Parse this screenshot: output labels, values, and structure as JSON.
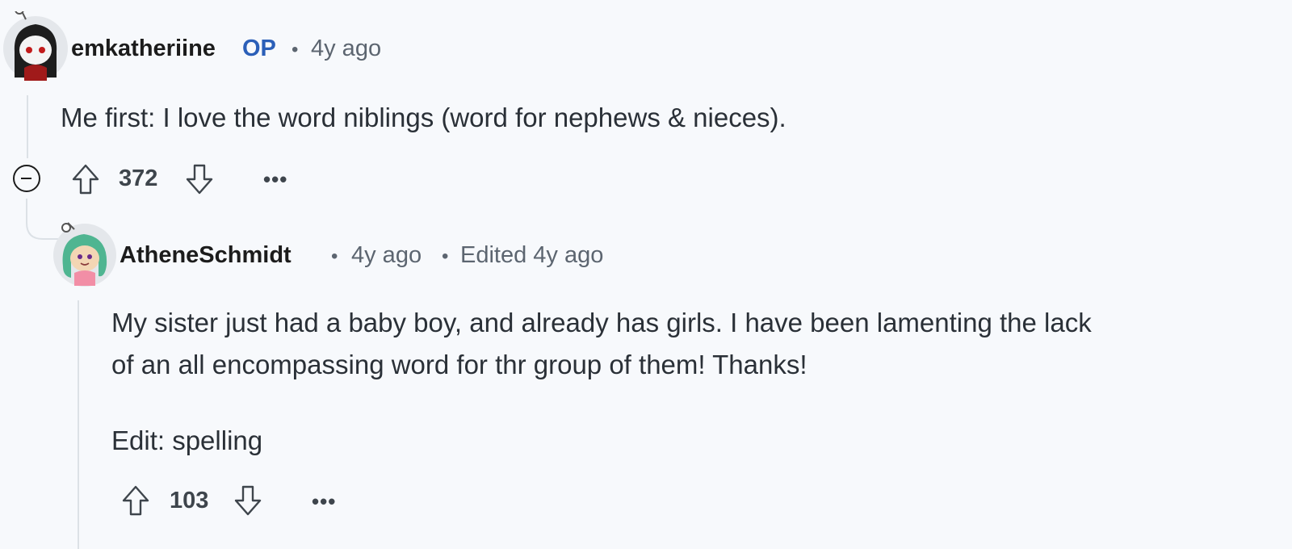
{
  "comments": [
    {
      "author": "emkatheriine",
      "op_badge": "OP",
      "separator": "•",
      "time": "4y ago",
      "body": "Me first: I love the word niblings (word for nephews & nieces).",
      "score": "372",
      "more": "•••",
      "avatar_icon": "snoo-avatar-dark-hair",
      "reply": {
        "author": "AtheneSchmidt",
        "separator": "•",
        "time": "4y ago",
        "separator2": "•",
        "edited": "Edited 4y ago",
        "body_line1": "My sister just had a baby boy, and already has girls. I have been lamenting the lack",
        "body_line2": "of an all encompassing word for thr group of them! Thanks!",
        "body_edit": "Edit: spelling",
        "score": "103",
        "more": "•••",
        "avatar_icon": "snoo-avatar-green-hair"
      }
    }
  ],
  "icons": {
    "upvote": "upvote-arrow-icon",
    "downvote": "downvote-arrow-icon",
    "collapse": "collapse-minus-icon"
  },
  "colors": {
    "background": "#f7f9fc",
    "op_badge": "#2b5fb8",
    "meta": "#5c6570",
    "thread_line": "#dce1e6"
  }
}
